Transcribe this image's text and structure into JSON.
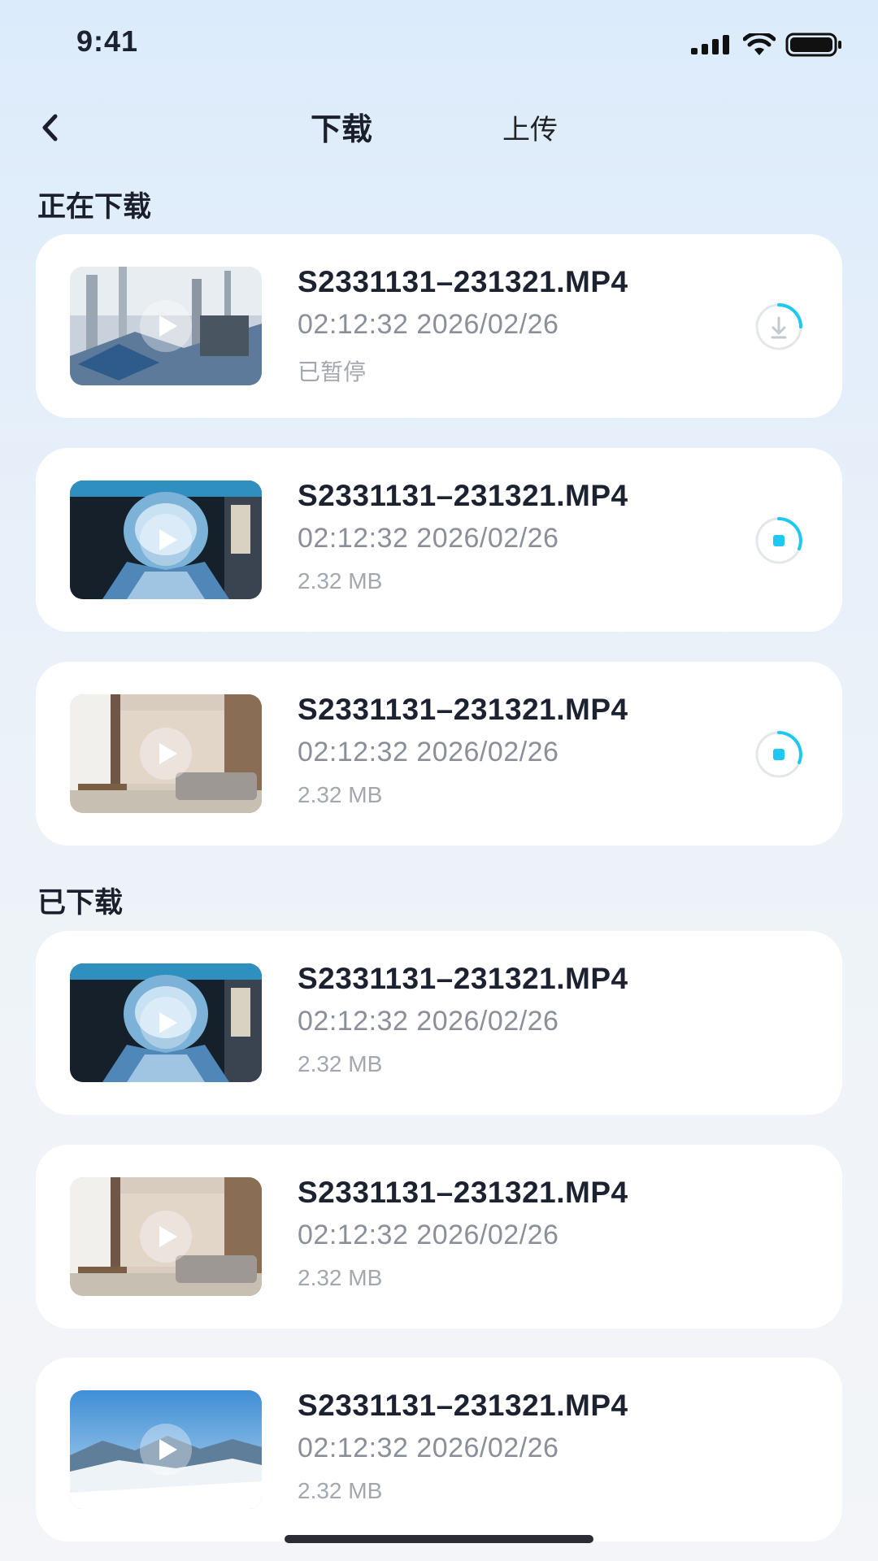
{
  "status_bar": {
    "time": "9:41"
  },
  "nav": {
    "tabs": [
      {
        "label": "下载"
      },
      {
        "label": "上传"
      }
    ]
  },
  "sections": {
    "downloading": {
      "title": "正在下载",
      "items": [
        {
          "name": "S2331131–231321.MP4",
          "datetime": "02:12:32 2026/02/26",
          "status": "已暂停",
          "icon": "download-paused-icon"
        },
        {
          "name": "S2331131–231321.MP4",
          "datetime": "02:12:32 2026/02/26",
          "status": "2.32 MB",
          "icon": "stop-download-icon"
        },
        {
          "name": "S2331131–231321.MP4",
          "datetime": "02:12:32 2026/02/26",
          "status": "2.32 MB",
          "icon": "stop-download-icon"
        }
      ]
    },
    "downloaded": {
      "title": "已下载",
      "items": [
        {
          "name": "S2331131–231321.MP4",
          "datetime": "02:12:32 2026/02/26",
          "size": "2.32 MB"
        },
        {
          "name": "S2331131–231321.MP4",
          "datetime": "02:12:32 2026/02/26",
          "size": "2.32 MB"
        },
        {
          "name": "S2331131–231321.MP4",
          "datetime": "02:12:32 2026/02/26",
          "size": "2.32 MB"
        }
      ]
    }
  },
  "colors": {
    "accent": "#1ec8ee",
    "muted_ring": "#e3e6ea"
  }
}
